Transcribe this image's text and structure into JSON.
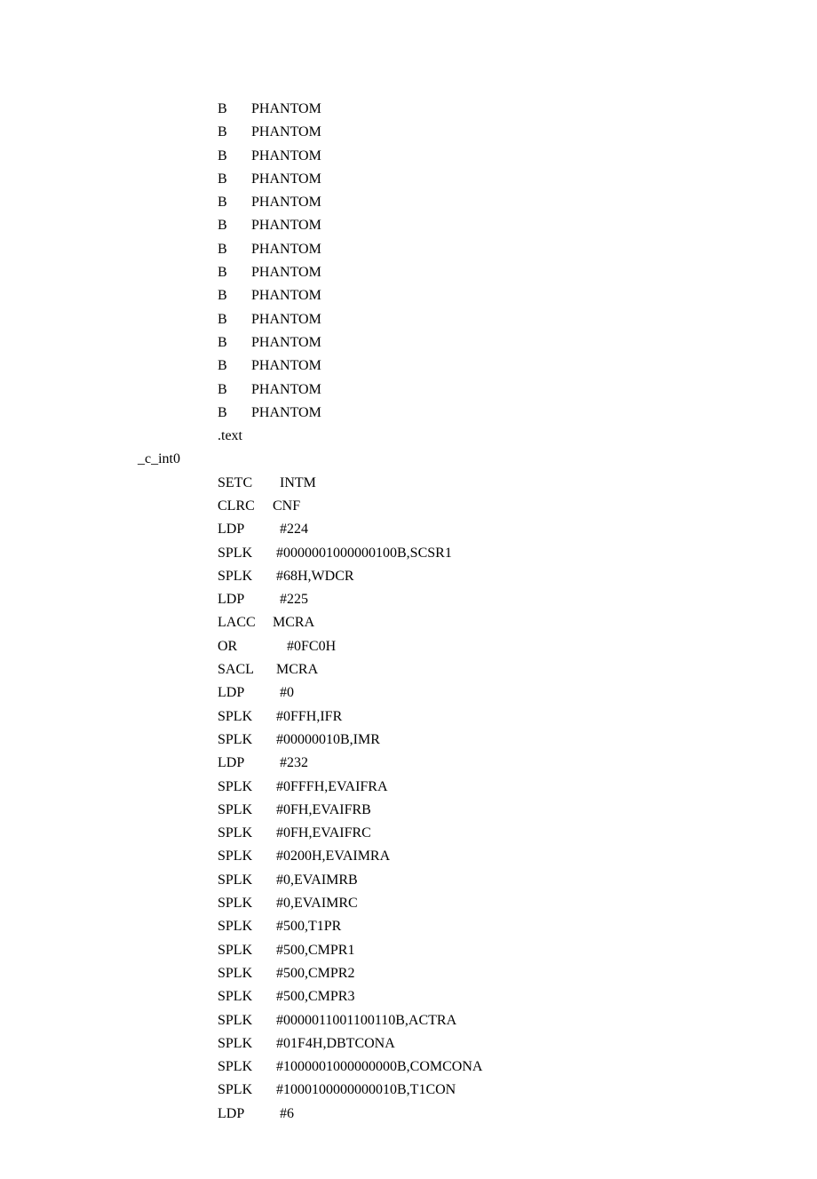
{
  "lines": [
    {
      "label": "",
      "op": "B",
      "arg": "PHANTOM"
    },
    {
      "label": "",
      "op": "B",
      "arg": "PHANTOM"
    },
    {
      "label": "",
      "op": "B",
      "arg": "PHANTOM"
    },
    {
      "label": "",
      "op": "B",
      "arg": "PHANTOM"
    },
    {
      "label": "",
      "op": "B",
      "arg": "PHANTOM"
    },
    {
      "label": "",
      "op": "B",
      "arg": "PHANTOM"
    },
    {
      "label": "",
      "op": "B",
      "arg": "PHANTOM"
    },
    {
      "label": "",
      "op": "B",
      "arg": "PHANTOM"
    },
    {
      "label": "",
      "op": "B",
      "arg": "PHANTOM"
    },
    {
      "label": "",
      "op": "B",
      "arg": "PHANTOM"
    },
    {
      "label": "",
      "op": "B",
      "arg": "PHANTOM"
    },
    {
      "label": "",
      "op": "B",
      "arg": "PHANTOM"
    },
    {
      "label": "",
      "op": "B",
      "arg": "PHANTOM"
    },
    {
      "label": "",
      "op": "B",
      "arg": "PHANTOM"
    },
    {
      "label": "",
      "op": ".text",
      "arg": ""
    },
    {
      "label": "_c_int0",
      "op": "",
      "arg": ""
    },
    {
      "label": "",
      "op": "SETC",
      "arg": "  INTM"
    },
    {
      "label": "",
      "op": "CLRC",
      "arg": "CNF"
    },
    {
      "label": "",
      "op": "LDP",
      "arg": "  #224"
    },
    {
      "label": "",
      "op": "SPLK",
      "arg": " #0000001000000100B,SCSR1"
    },
    {
      "label": "",
      "op": "SPLK",
      "arg": " #68H,WDCR"
    },
    {
      "label": "",
      "op": "LDP",
      "arg": "  #225"
    },
    {
      "label": "",
      "op": "LACC",
      "arg": "MCRA"
    },
    {
      "label": "",
      "op": "OR",
      "arg": "    #0FC0H"
    },
    {
      "label": "",
      "op": "SACL",
      "arg": " MCRA"
    },
    {
      "label": "",
      "op": "LDP",
      "arg": "  #0"
    },
    {
      "label": "",
      "op": "SPLK",
      "arg": " #0FFH,IFR"
    },
    {
      "label": "",
      "op": "SPLK",
      "arg": " #00000010B,IMR"
    },
    {
      "label": "",
      "op": "LDP",
      "arg": "  #232"
    },
    {
      "label": "",
      "op": "SPLK",
      "arg": " #0FFFH,EVAIFRA"
    },
    {
      "label": "",
      "op": "SPLK",
      "arg": " #0FH,EVAIFRB"
    },
    {
      "label": "",
      "op": "SPLK",
      "arg": " #0FH,EVAIFRC"
    },
    {
      "label": "",
      "op": "SPLK",
      "arg": " #0200H,EVAIMRA"
    },
    {
      "label": "",
      "op": "SPLK",
      "arg": " #0,EVAIMRB"
    },
    {
      "label": "",
      "op": "SPLK",
      "arg": " #0,EVAIMRC"
    },
    {
      "label": "",
      "op": "SPLK",
      "arg": " #500,T1PR"
    },
    {
      "label": "",
      "op": "SPLK",
      "arg": " #500,CMPR1"
    },
    {
      "label": "",
      "op": "SPLK",
      "arg": " #500,CMPR2"
    },
    {
      "label": "",
      "op": "SPLK",
      "arg": " #500,CMPR3"
    },
    {
      "label": "",
      "op": "SPLK",
      "arg": " #0000011001100110B,ACTRA"
    },
    {
      "label": "",
      "op": "SPLK",
      "arg": " #01F4H,DBTCONA"
    },
    {
      "label": "",
      "op": "SPLK",
      "arg": " #1000001000000000B,COMCONA"
    },
    {
      "label": "",
      "op": "SPLK",
      "arg": " #1000100000000010B,T1CON"
    },
    {
      "label": "",
      "op": "LDP",
      "arg": "  #6"
    }
  ]
}
